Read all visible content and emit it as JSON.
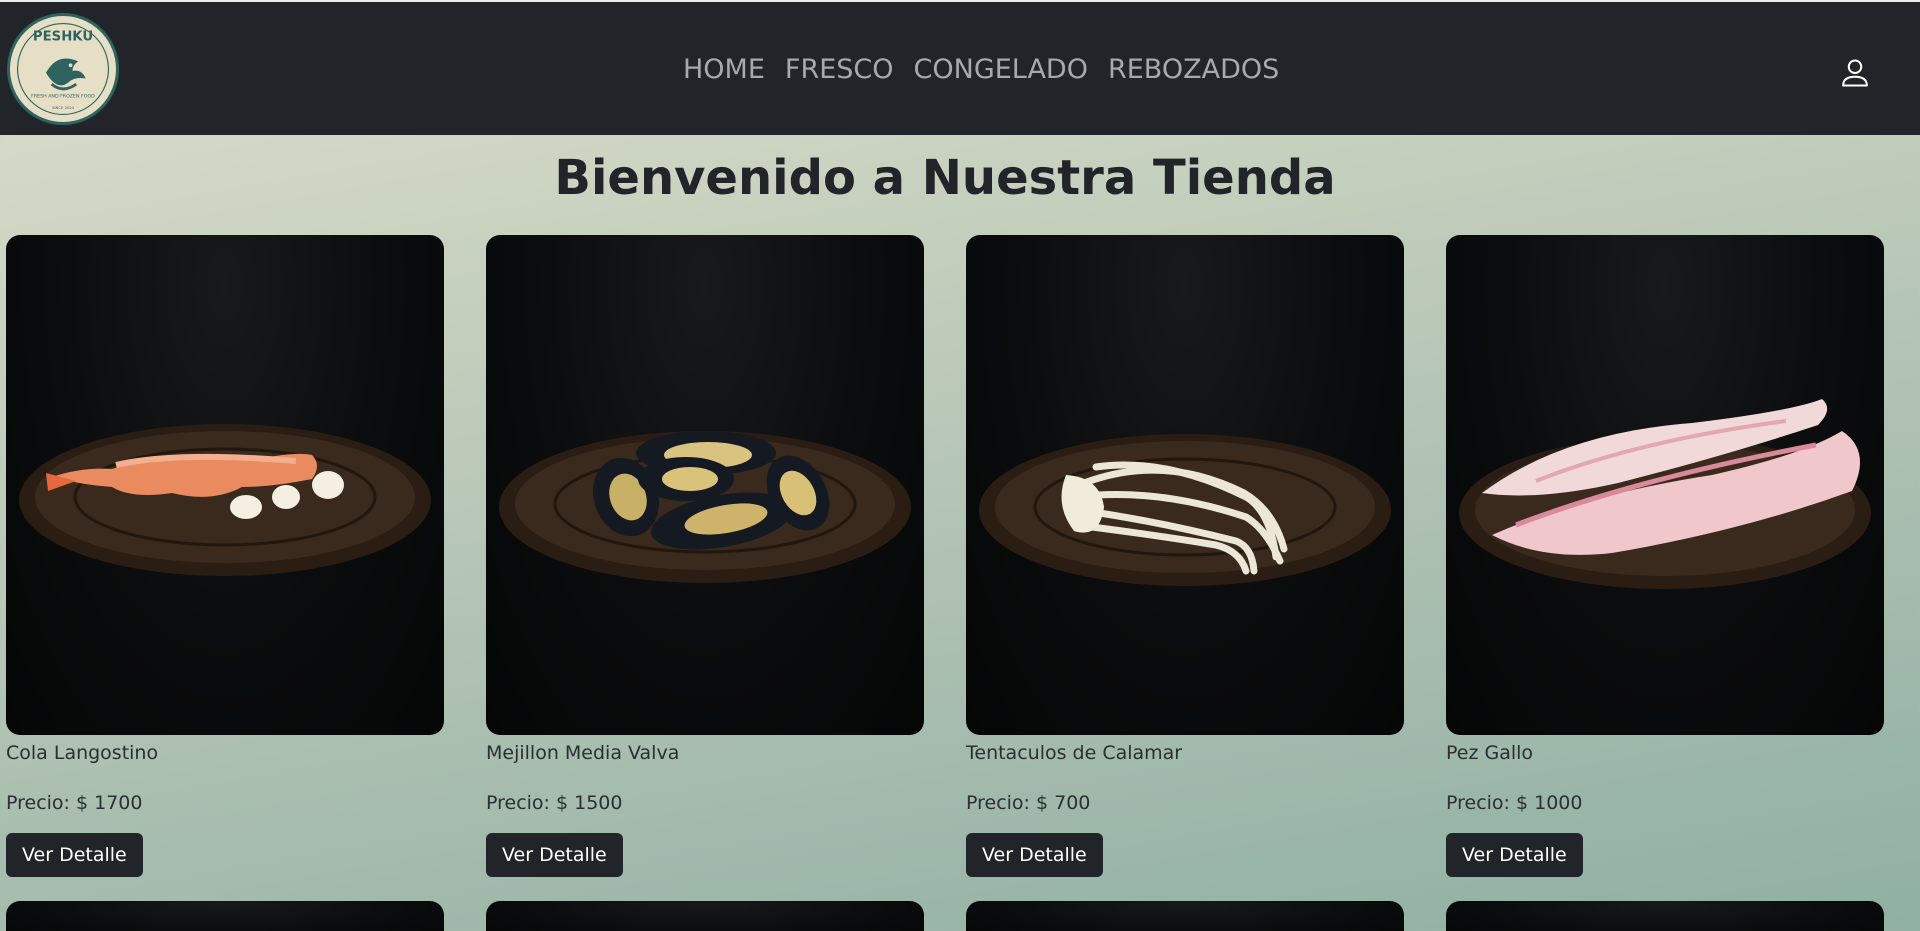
{
  "header": {
    "logo_text": "PESHKU",
    "logo_tagline": "FRESH AND FROZEN FOOD",
    "logo_since": "SINCE 2024",
    "nav": [
      {
        "label": "HOME"
      },
      {
        "label": "FRESCO"
      },
      {
        "label": "CONGELADO"
      },
      {
        "label": "REBOZADOS"
      }
    ],
    "user_icon": "user-icon"
  },
  "main": {
    "title": "Bienvenido a Nuestra Tienda",
    "products": [
      {
        "name": "Cola Langostino",
        "price": "Precio: $ 1700",
        "button": "Ver Detalle",
        "image": "shrimp-tails-plate"
      },
      {
        "name": "Mejillon Media Valva",
        "price": "Precio: $ 1500",
        "button": "Ver Detalle",
        "image": "half-shell-mussels-plate"
      },
      {
        "name": "Tentaculos de Calamar",
        "price": "Precio: $ 700",
        "button": "Ver Detalle",
        "image": "squid-tentacles-plate"
      },
      {
        "name": "Pez Gallo",
        "price": "Precio: $ 1000",
        "button": "Ver Detalle",
        "image": "fish-fillets-plate"
      }
    ]
  },
  "colors": {
    "navbar_bg": "#212529",
    "nav_text": "#a6a9ad",
    "button_bg": "#212529",
    "button_text": "#ffffff",
    "logo_bg": "#e6dfc6",
    "logo_accent": "#2e6460"
  }
}
